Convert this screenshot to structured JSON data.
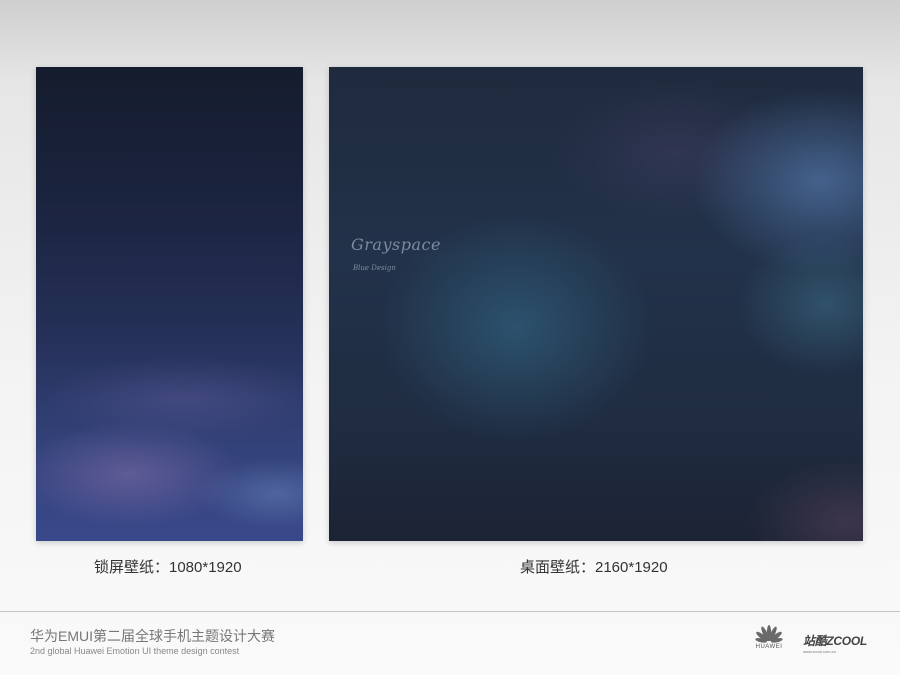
{
  "wallpapers": {
    "lock": {
      "caption": "锁屏壁纸：1080*1920"
    },
    "desktop": {
      "caption": "桌面壁纸：2160*1920",
      "signature": "Grayspace",
      "signature_sub": "Blue Design"
    }
  },
  "footer": {
    "contest_title": "华为EMUI第二届全球手机主题设计大赛",
    "contest_subtitle": "2nd global Huawei Emotion UI theme design contest",
    "huawei_label": "HUAWEI",
    "zcool_label": "站酷ZCOOL",
    "zcool_url": "www.zcool.com.cn"
  },
  "icons": {
    "huawei": "huawei-petal-logo",
    "zcool": "zcool-wordmark"
  },
  "colors": {
    "huawei_logo": "#6a6a6a"
  }
}
